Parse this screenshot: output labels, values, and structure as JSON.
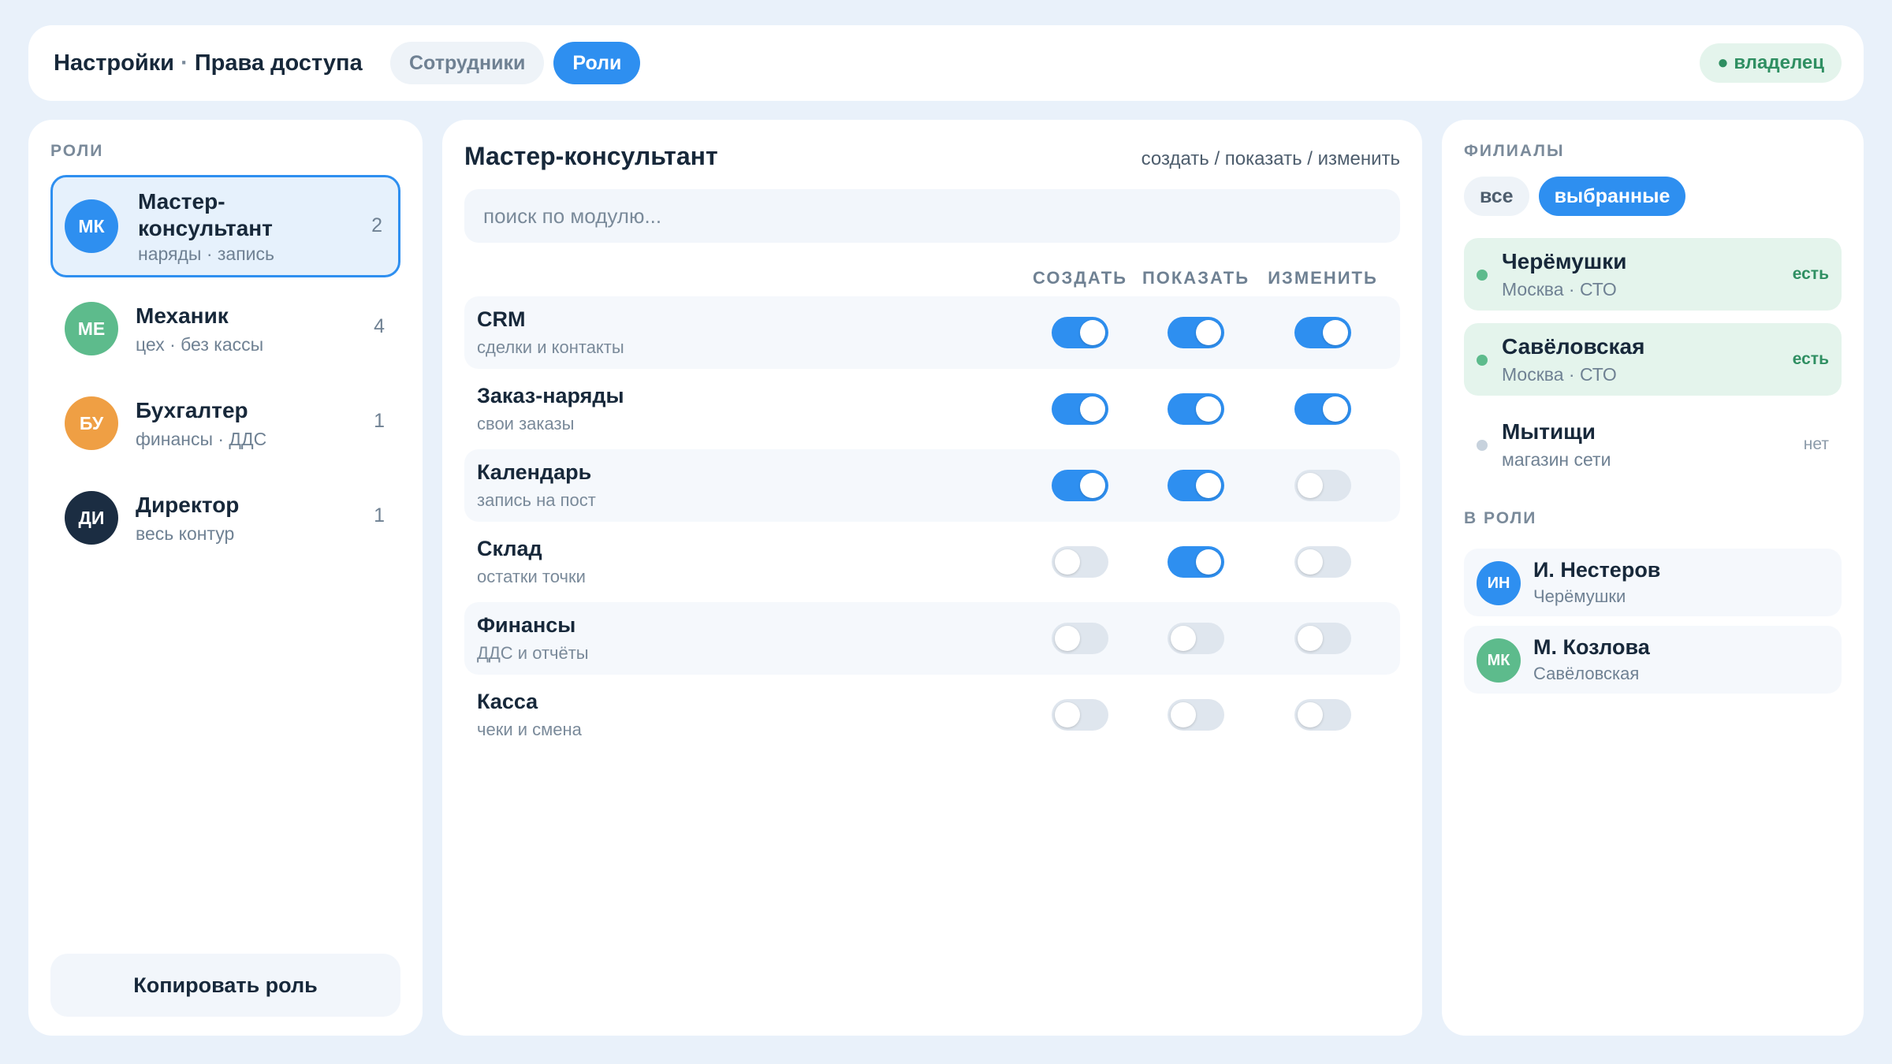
{
  "header": {
    "title_section": "Настройки",
    "title_separator": "·",
    "title_page": "Права доступа",
    "tabs": [
      {
        "label": "Сотрудники",
        "active": false
      },
      {
        "label": "Роли",
        "active": true
      }
    ],
    "owner_badge": "● владелец"
  },
  "roles_panel": {
    "section_label": "РОЛИ",
    "roles": [
      {
        "initials": "МК",
        "name": "Мастер-консультант",
        "subtitle": "наряды · запись",
        "count": "2",
        "color": "#2e8ff0",
        "selected": true
      },
      {
        "initials": "МЕ",
        "name": "Механик",
        "subtitle": "цех · без кассы",
        "count": "4",
        "color": "#5dbb8c",
        "selected": false
      },
      {
        "initials": "БУ",
        "name": "Бухгалтер",
        "subtitle": "финансы · ДДС",
        "count": "1",
        "color": "#ef9f44",
        "selected": false
      },
      {
        "initials": "ДИ",
        "name": "Директор",
        "subtitle": "весь контур",
        "count": "1",
        "color": "#1b2d42",
        "selected": false
      }
    ],
    "copy_button": "Копировать роль"
  },
  "permissions": {
    "role_title": "Мастер-консультант",
    "hint": "создать / показать / изменить",
    "search_placeholder": "поиск по модулю...",
    "columns": [
      "СОЗДАТЬ",
      "ПОКАЗАТЬ",
      "ИЗМЕНИТЬ"
    ],
    "modules": [
      {
        "name": "CRM",
        "subtitle": "сделки и контакты",
        "create": true,
        "view": true,
        "edit": true
      },
      {
        "name": "Заказ-наряды",
        "subtitle": "свои заказы",
        "create": true,
        "view": true,
        "edit": true
      },
      {
        "name": "Календарь",
        "subtitle": "запись на пост",
        "create": true,
        "view": true,
        "edit": false
      },
      {
        "name": "Склад",
        "subtitle": "остатки точки",
        "create": false,
        "view": true,
        "edit": false
      },
      {
        "name": "Финансы",
        "subtitle": "ДДС и отчёты",
        "create": false,
        "view": false,
        "edit": false
      },
      {
        "name": "Касса",
        "subtitle": "чеки и смена",
        "create": false,
        "view": false,
        "edit": false
      }
    ]
  },
  "branches_panel": {
    "section_label": "ФИЛИАЛЫ",
    "filters": [
      {
        "label": "все",
        "active": false
      },
      {
        "label": "выбранные",
        "active": true
      }
    ],
    "branches": [
      {
        "name": "Черёмушки",
        "subtitle": "Москва · СТО",
        "status": "есть",
        "has": true
      },
      {
        "name": "Савёловская",
        "subtitle": "Москва · СТО",
        "status": "есть",
        "has": true
      },
      {
        "name": "Мытищи",
        "subtitle": "магазин сети",
        "status": "нет",
        "has": false
      }
    ],
    "members_label": "В РОЛИ",
    "members": [
      {
        "initials": "ИН",
        "name": "И. Нестеров",
        "subtitle": "Черёмушки",
        "color": "#2e8ff0"
      },
      {
        "initials": "МК",
        "name": "М. Козлова",
        "subtitle": "Савёловская",
        "color": "#5dbb8c"
      }
    ]
  },
  "colors": {
    "accent": "#2e8ff0",
    "success": "#2f8f62",
    "success_bg": "#e4f4ec",
    "background": "#e9f1fa"
  }
}
